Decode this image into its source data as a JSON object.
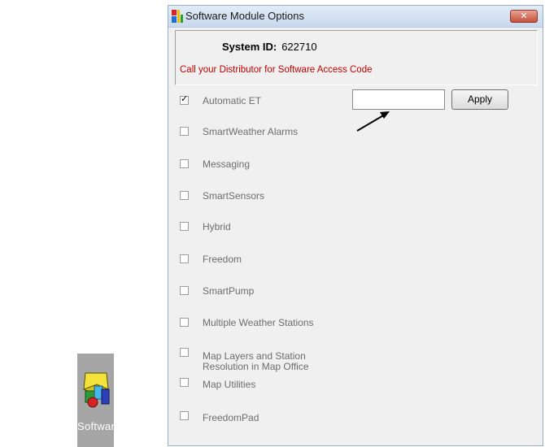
{
  "desktop": {
    "shortcut_label": "Softwar..."
  },
  "dialog": {
    "title": "Software Module Options",
    "close_glyph": "✕",
    "system_id_label": "System ID:",
    "system_id_value": "622710",
    "distributor_note": "Call your Distributor for Software Access Code",
    "access_code_value": "",
    "apply_label": "Apply",
    "options": [
      {
        "label": "Automatic ET",
        "checked": true
      },
      {
        "label": "SmartWeather Alarms",
        "checked": false
      },
      {
        "label": "Messaging",
        "checked": false
      },
      {
        "label": "SmartSensors",
        "checked": false
      },
      {
        "label": "Hybrid",
        "checked": false
      },
      {
        "label": "Freedom",
        "checked": false
      },
      {
        "label": "SmartPump",
        "checked": false
      },
      {
        "label": "Multiple Weather Stations",
        "checked": false
      },
      {
        "label": "Map Layers and Station",
        "label_line2": "Resolution in Map Office",
        "checked": false
      },
      {
        "label": "Map Utilities",
        "checked": false
      },
      {
        "label": "FreedomPad",
        "checked": false
      }
    ]
  },
  "colors": {
    "note_red": "#c00000",
    "disabled_text": "#6d6d6d",
    "close_button": "#c8503b"
  }
}
